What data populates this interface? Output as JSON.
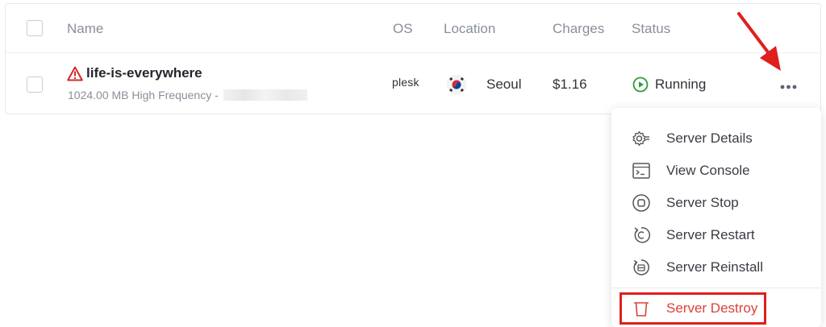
{
  "columns": {
    "name": "Name",
    "os": "OS",
    "location": "Location",
    "charges": "Charges",
    "status": "Status"
  },
  "server": {
    "name": "life-is-everywhere",
    "plan": "1024.00 MB High Frequency -",
    "os_logo_text": "plesk",
    "location": "Seoul",
    "charges": "$1.16",
    "status": "Running",
    "warning_icon": "warning-triangle-icon",
    "flag_icon": "south-korea-flag-icon"
  },
  "colors": {
    "running_green": "#2e9a3c",
    "warning_red": "#d32a2a",
    "annotation_red": "#e0201d",
    "destroy_red": "#d9423b"
  },
  "menu": {
    "items": [
      {
        "label": "Server Details",
        "icon": "gear-list-icon"
      },
      {
        "label": "View Console",
        "icon": "console-icon"
      },
      {
        "label": "Server Stop",
        "icon": "stop-icon"
      },
      {
        "label": "Server Restart",
        "icon": "restart-icon"
      },
      {
        "label": "Server Reinstall",
        "icon": "reinstall-icon"
      }
    ],
    "destroy": {
      "label": "Server Destroy",
      "icon": "trash-icon"
    }
  }
}
